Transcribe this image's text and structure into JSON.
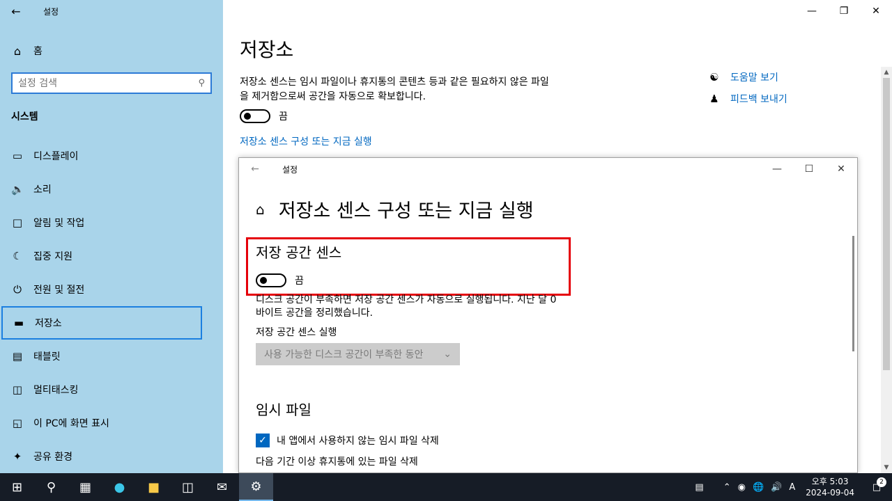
{
  "window": {
    "title": "설정",
    "back_icon": "arrow-left-icon",
    "minimize": "—",
    "restore": "❐",
    "close": "✕"
  },
  "sidebar": {
    "home_label": "홈",
    "search_placeholder": "설정 검색",
    "section_title": "시스템",
    "items": [
      {
        "label": "디스플레이",
        "icon": "monitor-icon"
      },
      {
        "label": "소리",
        "icon": "speaker-icon"
      },
      {
        "label": "알림 및 작업",
        "icon": "notification-icon"
      },
      {
        "label": "집중 지원",
        "icon": "moon-icon"
      },
      {
        "label": "전원 및 절전",
        "icon": "power-icon"
      },
      {
        "label": "저장소",
        "icon": "storage-icon",
        "selected": true
      },
      {
        "label": "태블릿",
        "icon": "tablet-icon"
      },
      {
        "label": "멀티태스킹",
        "icon": "multitask-icon"
      },
      {
        "label": "이 PC에 화면 표시",
        "icon": "project-icon"
      },
      {
        "label": "공유 환경",
        "icon": "share-icon"
      }
    ]
  },
  "main": {
    "title": "저장소",
    "description": "저장소 센스는 임시 파일이나 휴지통의 콘텐츠 등과 같은 필요하지 않은 파일을 제거함으로써 공간을 자동으로 확보합니다.",
    "toggle_state": "끔",
    "configure_link": "저장소 센스 구성 또는 지금 실행",
    "help_link": "도움말 보기",
    "feedback_link": "피드백 보내기"
  },
  "child_window": {
    "title": "설정",
    "heading": "저장소 센스 구성 또는 지금 실행",
    "sense_title": "저장 공간 센스",
    "sense_toggle_state": "끔",
    "sense_description": "디스크 공간이 부족하면 저장 공간 센스가 자동으로 실행됩니다. 지난 달 0바이트 공간을 정리했습니다.",
    "run_label": "저장 공간 센스 실행",
    "run_dropdown_value": "사용 가능한 디스크 공간이 부족한 동안",
    "temp_title": "임시 파일",
    "delete_temp_label": "내 앱에서 사용하지 않는 임시 파일 삭제",
    "delete_temp_checked": true,
    "recycle_label": "다음 기간 이상 휴지통에 있는 파일 삭제"
  },
  "taskbar": {
    "time": "오후 5:03",
    "date": "2024-09-04",
    "notification_count": "2",
    "ime": "A",
    "accent_color": "#76b9ed"
  }
}
